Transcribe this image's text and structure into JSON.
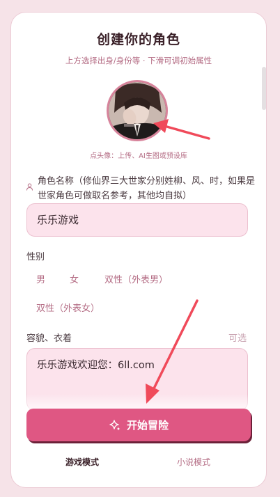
{
  "header": {
    "title": "创建你的角色",
    "subtitle": "上方选择出身/身份等 · 下滑可调初始属性"
  },
  "avatar": {
    "hint": "点头像：上传、AI生图或预设库"
  },
  "name_field": {
    "label": "角色名称（修仙界三大世家分别姓柳、风、时，如果是世家角色可做取名参考，其他均自拟）",
    "value": "乐乐游戏"
  },
  "gender": {
    "label": "性别",
    "options": [
      "男",
      "女",
      "双性（外表男）",
      "双性（外表女）"
    ]
  },
  "appearance": {
    "label": "容貌、衣着",
    "optional_tag": "可选",
    "value": "乐乐游戏欢迎您：6ll.com"
  },
  "actions": {
    "start_label": "开始冒险"
  },
  "modes": {
    "game": "游戏模式",
    "novel": "小说模式"
  },
  "colors": {
    "accent": "#df5783",
    "arrow": "#f04a5a",
    "input_bg": "#fce3ec"
  }
}
